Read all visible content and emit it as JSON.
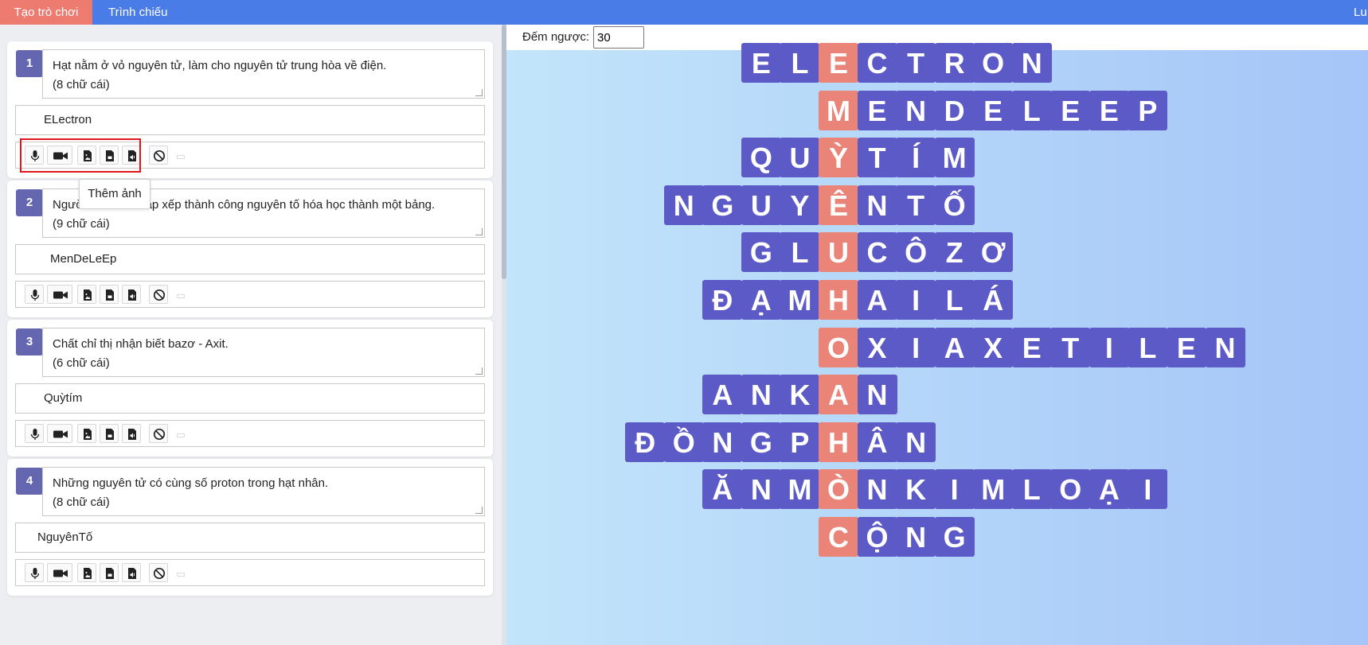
{
  "topbar": {
    "tab_create": "Tạo trò chơi",
    "tab_slideshow": "Trình chiếu",
    "right_label": "Lu"
  },
  "tooltip": "Thêm ảnh",
  "questions": [
    {
      "number": "1",
      "line1": "Hạt nằm ở vỏ nguyên tử, làm cho nguyên tử trung hòa về điện.",
      "line2": "(8 chữ cái)",
      "answer": "ELectron"
    },
    {
      "number": "2",
      "line1": "Người tìm ra và sắp xếp thành công nguyên tố hóa học thành một bảng.",
      "line2": "(9 chữ cái)",
      "answer": "MenDeLeEp"
    },
    {
      "number": "3",
      "line1": "Chất chỉ thị nhận biết bazơ - Axit.",
      "line2": "(6 chữ cái)",
      "answer": "Quỳtím"
    },
    {
      "number": "4",
      "line1": "Những nguyên tử có cùng số proton trong hạt nhân.",
      "line2": "(8 chữ cái)",
      "answer": "NguyênTố"
    }
  ],
  "countdown": {
    "label": "Đếm ngược:",
    "value": "30"
  },
  "crossword": {
    "key_color": "#ea8378",
    "cell_color": "#5c5ac6",
    "rows": [
      {
        "letters": [
          "E",
          "L",
          "E",
          "C",
          "T",
          "R",
          "O",
          "N"
        ],
        "key_index": 2
      },
      {
        "letters": [
          "M",
          "E",
          "N",
          "D",
          "E",
          "L",
          "E",
          "E",
          "P"
        ],
        "key_index": 0
      },
      {
        "letters": [
          "Q",
          "U",
          "Ỳ",
          "T",
          "Í",
          "M"
        ],
        "key_index": 2
      },
      {
        "letters": [
          "N",
          "G",
          "U",
          "Y",
          "Ê",
          "N",
          "T",
          "Ố"
        ],
        "key_index": 4
      },
      {
        "letters": [
          "G",
          "L",
          "U",
          "C",
          "Ô",
          "Z",
          "Ơ"
        ],
        "key_index": 2
      },
      {
        "letters": [
          "Đ",
          "Ạ",
          "M",
          "H",
          "A",
          "I",
          "L",
          "Á"
        ],
        "key_index": 3
      },
      {
        "letters": [
          "O",
          "X",
          "I",
          "A",
          "X",
          "E",
          "T",
          "I",
          "L",
          "E",
          "N"
        ],
        "key_index": 0
      },
      {
        "letters": [
          "A",
          "N",
          "K",
          "A",
          "N"
        ],
        "key_index": 3
      },
      {
        "letters": [
          "Đ",
          "Ồ",
          "N",
          "G",
          "P",
          "H",
          "Â",
          "N"
        ],
        "key_index": 5
      },
      {
        "letters": [
          "Ă",
          "N",
          "M",
          "Ò",
          "N",
          "K",
          "I",
          "M",
          "L",
          "O",
          "Ạ",
          "I"
        ],
        "key_index": 3
      },
      {
        "letters": [
          "C",
          "Ộ",
          "N",
          "G"
        ],
        "key_index": 0
      }
    ]
  }
}
